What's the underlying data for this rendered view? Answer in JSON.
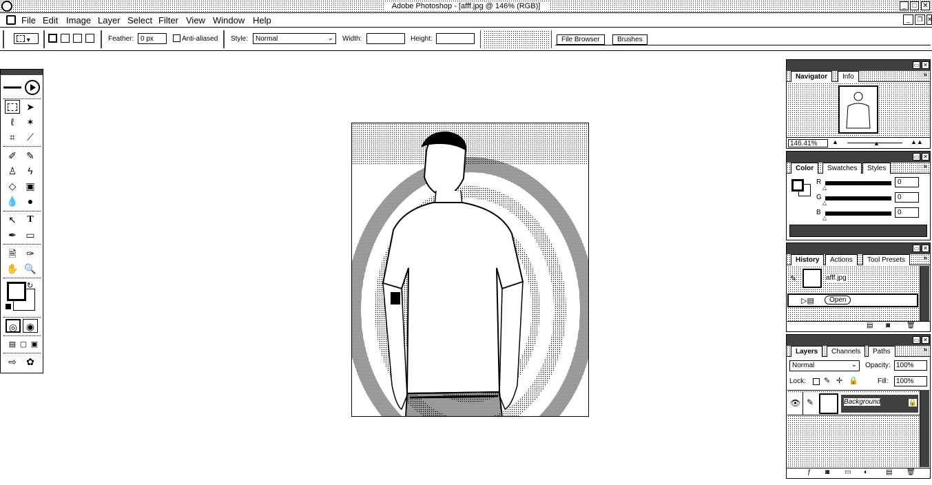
{
  "window": {
    "title": "Adobe Photoshop - [afff.jpg @ 146% (RGB)]",
    "controls": {
      "minimize": "_",
      "maximize": "□",
      "close": "✕"
    }
  },
  "menubar": {
    "items": [
      "File",
      "Edit",
      "Image",
      "Layer",
      "Select",
      "Filter",
      "View",
      "Window",
      "Help"
    ],
    "doc_controls": {
      "minimize": "_",
      "restore": "❐",
      "close": "✕"
    }
  },
  "options": {
    "feather_label": "Feather:",
    "feather_value": "0 px",
    "antialiased_label": "Anti-aliased",
    "style_label": "Style:",
    "style_value": "Normal",
    "width_label": "Width:",
    "width_value": "",
    "height_label": "Height:",
    "height_value": "",
    "well_tabs": [
      "File Browser",
      "Brushes"
    ]
  },
  "navigator": {
    "tabs": [
      "Navigator",
      "Info"
    ],
    "zoom_value": "146.41%"
  },
  "color": {
    "tabs": [
      "Color",
      "Swatches",
      "Styles"
    ],
    "channels": [
      {
        "label": "R",
        "value": "0"
      },
      {
        "label": "G",
        "value": "0"
      },
      {
        "label": "B",
        "value": "0"
      }
    ]
  },
  "history": {
    "tabs": [
      "History",
      "Actions",
      "Tool Presets"
    ],
    "snapshot": "afff.jpg",
    "states": [
      "Open"
    ]
  },
  "layers": {
    "tabs": [
      "Layers",
      "Channels",
      "Paths"
    ],
    "blend_mode": "Normal",
    "opacity_label": "Opacity:",
    "opacity_value": "100%",
    "lock_label": "Lock:",
    "fill_label": "Fill:",
    "fill_value": "100%",
    "layer_name": "Background"
  },
  "palette_arrow": "»"
}
